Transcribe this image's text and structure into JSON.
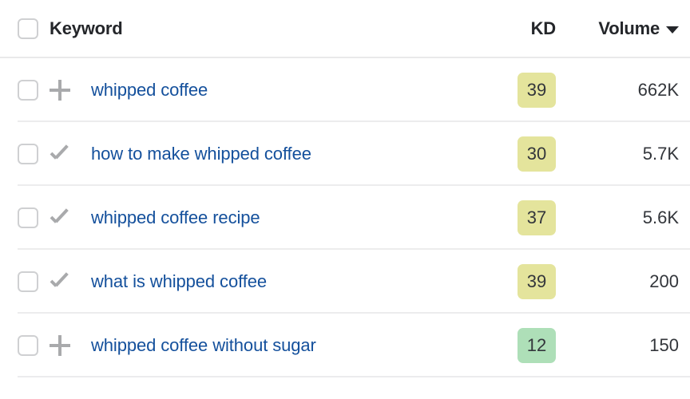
{
  "table": {
    "header": {
      "select_all_checkbox": "select-all",
      "keyword_label": "Keyword",
      "kd_label": "KD",
      "volume_label": "Volume",
      "sort_indicator": "chevron-down-icon",
      "sorted_column": "Volume",
      "sort_direction": "descending"
    },
    "rows": [
      {
        "checkbox_checked": false,
        "action_icon": "plus-icon",
        "keyword": "whipped coffee",
        "kd": "39",
        "kd_color": "#e4e49c",
        "volume": "662K"
      },
      {
        "checkbox_checked": false,
        "action_icon": "check-icon",
        "keyword": "how to make whipped coffee",
        "kd": "30",
        "kd_color": "#e4e49c",
        "volume": "5.7K"
      },
      {
        "checkbox_checked": false,
        "action_icon": "check-icon",
        "keyword": "whipped coffee recipe",
        "kd": "37",
        "kd_color": "#e4e49c",
        "volume": "5.6K"
      },
      {
        "checkbox_checked": false,
        "action_icon": "check-icon",
        "keyword": "what is whipped coffee",
        "kd": "39",
        "kd_color": "#e4e49c",
        "volume": "200"
      },
      {
        "checkbox_checked": false,
        "action_icon": "plus-icon",
        "keyword": "whipped coffee without sugar",
        "kd": "12",
        "kd_color": "#aedfb8",
        "volume": "150"
      }
    ]
  },
  "colors": {
    "link": "#14509c",
    "text": "#33363b",
    "header_text": "#24262a",
    "divider": "#ececed",
    "checkbox_border": "#cfd0d2",
    "icon_gray": "#a9aaac",
    "kd_medium": "#e4e49c",
    "kd_easy": "#aedfb8"
  }
}
